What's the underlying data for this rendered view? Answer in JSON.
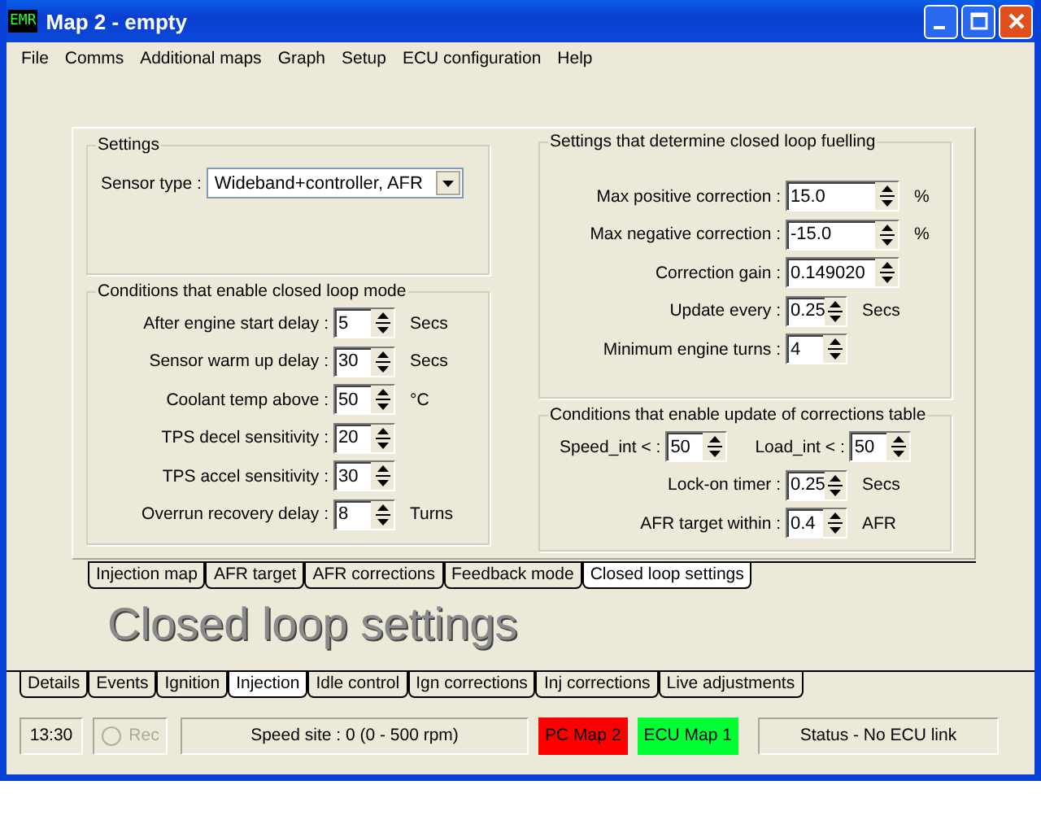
{
  "window": {
    "icon_text": "EMR",
    "title": "Map 2 - empty"
  },
  "menu": [
    "File",
    "Comms",
    "Additional maps",
    "Graph",
    "Setup",
    "ECU configuration",
    "Help"
  ],
  "settings": {
    "title": "Settings",
    "sensor_label": "Sensor type :",
    "sensor_value": "Wideband+controller, AFR"
  },
  "closed_loop_conditions": {
    "title": "Conditions that enable closed loop mode",
    "rows": [
      {
        "label": "After engine start delay :",
        "value": "5",
        "unit": "Secs"
      },
      {
        "label": "Sensor warm up delay :",
        "value": "30",
        "unit": "Secs"
      },
      {
        "label": "Coolant temp above :",
        "value": "50",
        "unit": "°C"
      },
      {
        "label": "TPS decel sensitivity :",
        "value": "20"
      },
      {
        "label": "TPS accel sensitivity :",
        "value": "30"
      },
      {
        "label": "Overrun recovery delay :",
        "value": "8",
        "unit": "Turns"
      }
    ]
  },
  "fuelling": {
    "title": "Settings that determine closed loop fuelling",
    "rows": [
      {
        "label": "Max positive correction :",
        "value": "15.0",
        "unit": "%"
      },
      {
        "label": "Max negative correction :",
        "value": "-15.0",
        "unit": "%"
      },
      {
        "label": "Correction gain :",
        "value": "0.149020"
      },
      {
        "label": "Update every :",
        "value": "0.25",
        "unit": "Secs"
      },
      {
        "label": "Minimum engine turns :",
        "value": "4"
      }
    ]
  },
  "update_conditions": {
    "title": "Conditions that enable update of corrections table",
    "pair": [
      {
        "label": "Speed_int < :",
        "value": "50"
      },
      {
        "label": "Load_int < :",
        "value": "50"
      }
    ],
    "rows": [
      {
        "label": "Lock-on timer :",
        "value": "0.25",
        "unit": "Secs"
      },
      {
        "label": "AFR target within :",
        "value": "0.4",
        "unit": "AFR"
      }
    ]
  },
  "page_tabs": [
    {
      "label": "Injection map",
      "selected": false
    },
    {
      "label": "AFR target",
      "selected": false
    },
    {
      "label": "AFR corrections",
      "selected": false
    },
    {
      "label": "Feedback mode",
      "selected": false
    },
    {
      "label": "Closed loop settings",
      "selected": true
    }
  ],
  "page_heading": "Closed loop settings",
  "section_tabs": [
    {
      "label": "Details",
      "selected": false
    },
    {
      "label": "Events",
      "selected": false
    },
    {
      "label": "Ignition",
      "selected": false
    },
    {
      "label": "Injection",
      "selected": true
    },
    {
      "label": "Idle control",
      "selected": false
    },
    {
      "label": "Ign corrections",
      "selected": false
    },
    {
      "label": "Inj corrections",
      "selected": false
    },
    {
      "label": "Live adjustments",
      "selected": false
    }
  ],
  "status_bar": {
    "time": "13:30",
    "rec": {
      "label": "Rec",
      "disabled": true,
      "checked": false
    },
    "speed_site": "Speed site : 0 (0 - 500 rpm)",
    "maps": [
      {
        "label": "PC Map 2",
        "color": "#ff0000"
      },
      {
        "label": "ECU Map 1",
        "color": "#00ff33"
      }
    ],
    "status": "Status - No ECU link"
  }
}
